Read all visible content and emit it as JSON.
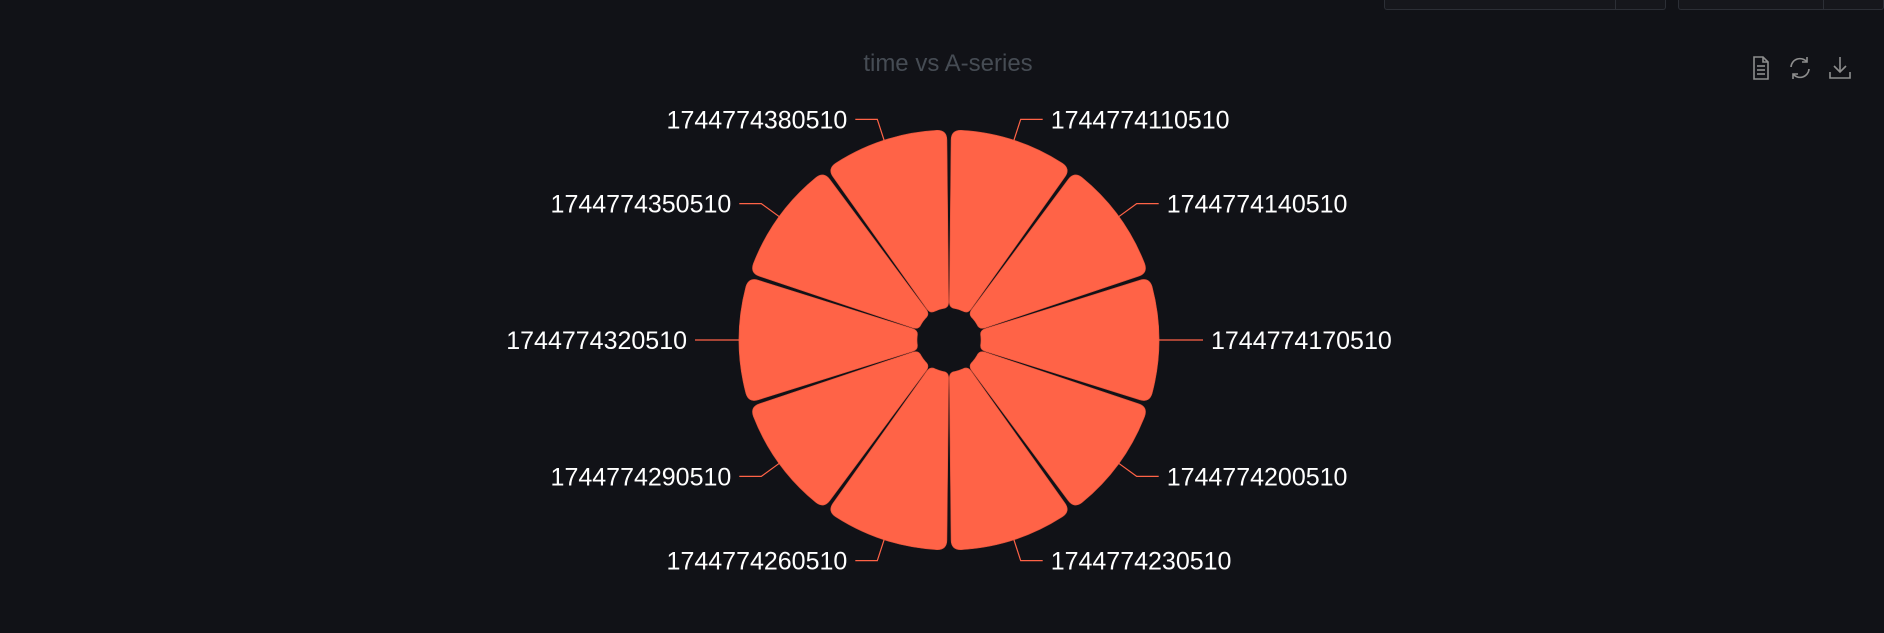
{
  "chart_data": {
    "type": "pie",
    "title": "time vs A-series",
    "categories": [
      "1744774110510",
      "1744774140510",
      "1744774170510",
      "1744774200510",
      "1744774230510",
      "1744774260510",
      "1744774290510",
      "1744774320510",
      "1744774350510",
      "1744774380510"
    ],
    "values": [
      1,
      1,
      1,
      1,
      1,
      1,
      1,
      1,
      1,
      1
    ],
    "color": "#ff6347",
    "background": "#111217",
    "legend": "none"
  },
  "toolbox": {
    "icons": [
      "data-view-icon",
      "restore-icon",
      "save-image-icon"
    ]
  }
}
